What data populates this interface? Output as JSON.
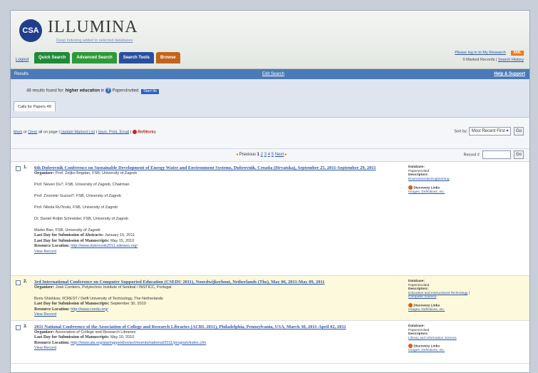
{
  "header": {
    "logo_letters": "CSA",
    "logo_title": "ILLUMINA",
    "tagline": "Deep Indexing added to selected databases",
    "logout": "Logout",
    "tabs": [
      {
        "label": "Quick Search",
        "color": "#1f8a3a"
      },
      {
        "label": "Advanced Search",
        "color": "#2d9a3a"
      },
      {
        "label": "Search Tools",
        "color": "#2a4f9e"
      },
      {
        "label": "Browse",
        "color": "#c3631e"
      }
    ],
    "login_link": "Please log in to My Research",
    "xml_badge": "XML",
    "marked_records": "0 Marked Records",
    "search_history": "Search History"
  },
  "results_bar": {
    "title": "Results",
    "edit_search": "Edit Search",
    "help": "Help & Support"
  },
  "summary": {
    "count_text": "48 results found for:",
    "query": "higher education",
    "in_text": "in",
    "database": "PapersInvited",
    "start_button": "Start Ite",
    "tab_label": "Calls for Papers 48"
  },
  "toolbar": {
    "mark": "Mark",
    "or": "or",
    "clear": "Clear",
    "all_on_page": "all on page |",
    "update_marked": "Update Marked List",
    "save_print_email": "Save, Print, Email",
    "refworks": "RefWorks",
    "sort_label": "Sort by:",
    "sort_value": "Most Recent First",
    "go": "Go"
  },
  "pager": {
    "previous": "Previous",
    "pages": [
      "1",
      "2",
      "3",
      "4",
      "5"
    ],
    "next": "Next",
    "record_label": "Record #",
    "go": "Go"
  },
  "records": [
    {
      "num": "1.",
      "title": "6th Dubrovnik Conference on Sustainable Development of Energy Water and Environment Systems, Dubrovnik, Croatia (Hrvatska), September 25, 2011-September 29, 2011",
      "organizer": "Prof. Zeljko Bogdan, FSB, University of Zagreb",
      "people": [
        "Prof. Neven Du?, FSB, University of Zagreb, Chairman",
        "Prof. Zvonimir Guzovi?, FSB, University of Zagreb",
        "Prof. Nikola Ru?inski, FSB, University of Zagreb",
        "Dr. Daniel Rolph Schneider, FSB, University of Zagreb",
        "Marko Ban, FSB, University of Zagreb"
      ],
      "abstracts": "January 15, 2011",
      "manuscripts": "May 15, 2010",
      "location": "http://www.dubrovnik2011.sdewes.org/",
      "view": "View Record",
      "side": {
        "db_label": "Database:",
        "db": "PapersInvited",
        "desc_label": "Descriptors:",
        "desc": "Environmental Engineering",
        "disc_label": "Discovery Links",
        "disc": "Images, Definitions, etc."
      }
    },
    {
      "num": "2.",
      "title": "3rd International Conference on Computer Supported Education (CSEDU 2011), Noordwijkerhout, Netherlands (The), May 06, 2011-May 09, 2011",
      "organizer": "José Cordeiro, Polytechnic Institute of Setúbal / INSTICC, Portugal",
      "people": [
        "Boris Shishkov, IICREST / Delft University of Technology, The Netherlands"
      ],
      "manuscripts": "September 30, 2010",
      "location": "http://www.csedu.org/",
      "view": "View Record",
      "side": {
        "db_label": "Database:",
        "db": "PapersInvited",
        "desc_label": "Descriptors:",
        "desc": "Education and Instructional Technology",
        "desc2": "Computer Science",
        "disc_label": "Discovery Links",
        "disc": "Images, Definitions, etc."
      }
    },
    {
      "num": "3.",
      "title": "2011 National Conference of the Association of College and Research Libraries (ACRL 2011), Philadelphia, Pennsylvania, USA, March 30, 2011-April 02, 2011",
      "organizer": "Association of College and Research Libraries",
      "manuscripts": "May 10, 2010",
      "location": "http://www.ala.org/ala/mgrps/divs/acrl/events/national/2011/program/index.cfm",
      "view": "View Record",
      "side": {
        "db_label": "Database:",
        "db": "PapersInvited",
        "desc_label": "Descriptors:",
        "desc": "Library and Information Science",
        "disc_label": "Discovery Links",
        "disc": "Images, Definitions, etc."
      }
    }
  ],
  "labels": {
    "organizer": "Organizer:",
    "abstracts": "Last Day for Submission of Abstracts:",
    "manuscripts": "Last Day for Submission of Manuscripts:",
    "location": "Resource Location:"
  }
}
